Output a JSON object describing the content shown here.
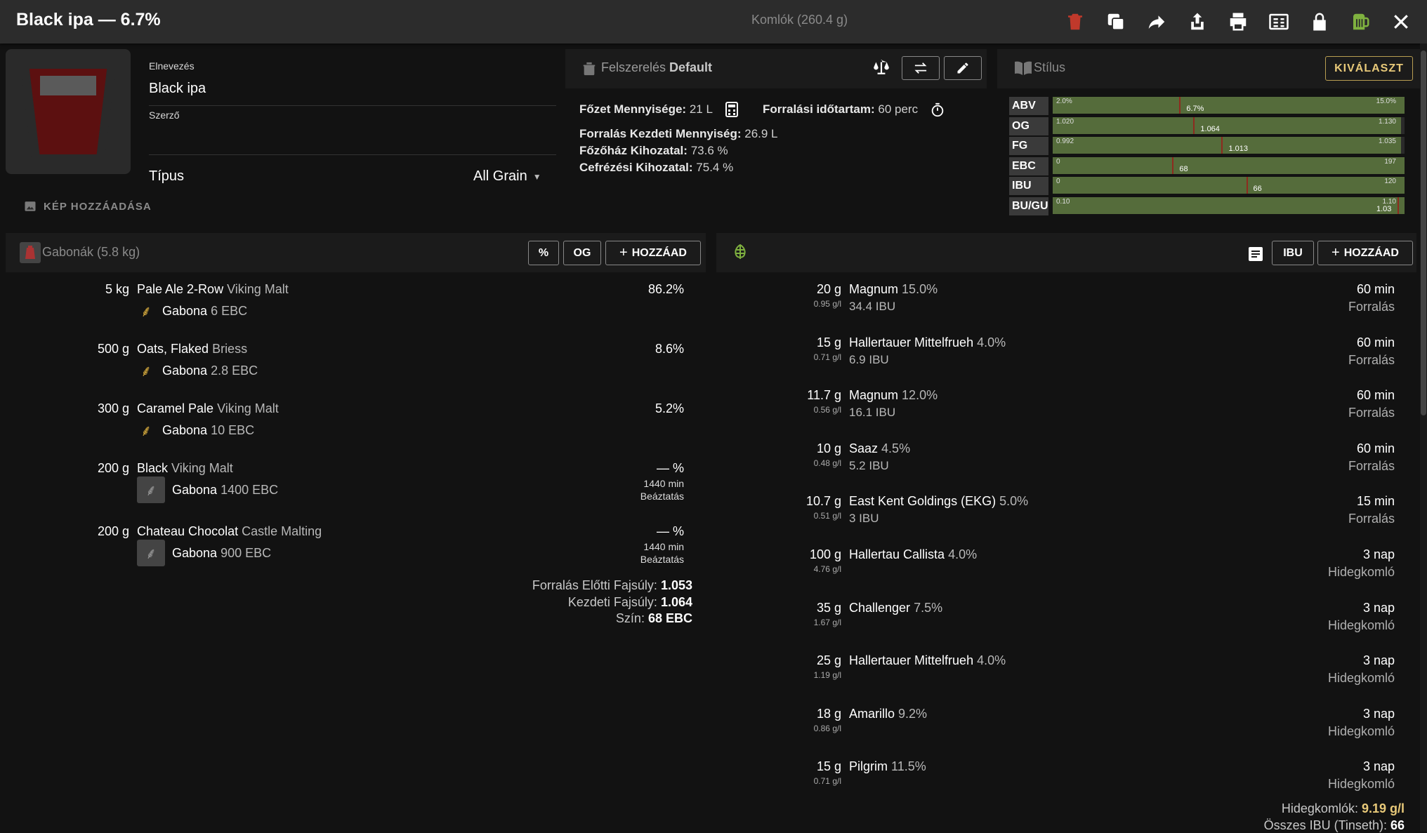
{
  "window": {
    "title": "Black ipa — 6.7%"
  },
  "toolbar": {
    "icons": [
      "trash-icon",
      "copy-icon",
      "share-icon",
      "export-icon",
      "print-icon",
      "newspaper-icon",
      "lock-icon",
      "beer-mug-icon",
      "close-icon"
    ]
  },
  "info": {
    "name_label": "Elnevezés",
    "name_value": "Black ipa",
    "author_label": "Szerző",
    "author_value": "",
    "type_label": "Típus",
    "type_value": "All Grain",
    "add_image": "KÉP HOZZÁADÁSA",
    "glass_color": "#5c1010"
  },
  "equipment": {
    "label": "Felszerelés",
    "value": "Default",
    "batch_label": "Főzet Mennyisége:",
    "batch_value": "21 L",
    "boil_time_label": "Forralási időtartam:",
    "boil_time_value": "60 perc",
    "boil_size_label": "Forralás Kezdeti Mennyiség:",
    "boil_size_value": "26.9 L",
    "brewhouse_label": "Főzőház Kihozatal:",
    "brewhouse_value": "73.6 %",
    "mash_label": "Cefrézési Kihozatal:",
    "mash_value": "75.4 %"
  },
  "style": {
    "label": "Stílus",
    "pick_label": "KIVÁLASZT",
    "gauges": [
      {
        "label": "ABV",
        "min": "2.0%",
        "max": "15.0%",
        "value": "6.7%",
        "range_start": 0.0,
        "range_end": 1.0,
        "marker": 0.36
      },
      {
        "label": "OG",
        "min": "1.020",
        "max": "1.130",
        "value": "1.064",
        "range_start": 0.0,
        "range_end": 0.99,
        "marker": 0.4
      },
      {
        "label": "FG",
        "min": "0.992",
        "max": "1.035",
        "value": "1.013",
        "range_start": 0.0,
        "range_end": 0.99,
        "marker": 0.48
      },
      {
        "label": "EBC",
        "min": "0",
        "max": "197",
        "value": "68",
        "range_start": 0.0,
        "range_end": 1.0,
        "marker": 0.34
      },
      {
        "label": "IBU",
        "min": "0",
        "max": "120",
        "value": "66",
        "range_start": 0.0,
        "range_end": 1.0,
        "marker": 0.55
      },
      {
        "label": "BU/GU",
        "min": "0.10",
        "max": "1.10",
        "value": "1.03",
        "range_start": 0.0,
        "range_end": 1.0,
        "marker": 0.98
      }
    ]
  },
  "grains": {
    "title": "Gabonák (5.8 kg)",
    "pct_button": "%",
    "og_button": "OG",
    "add_button": "HOZZÁAD",
    "items": [
      {
        "amount": "5 kg",
        "name": "Pale Ale 2-Row",
        "supplier": "Viking Malt",
        "type": "Gabona",
        "color": "6 EBC",
        "pct": "86.2%",
        "time": "",
        "use": ""
      },
      {
        "amount": "500 g",
        "name": "Oats, Flaked",
        "supplier": "Briess",
        "type": "Gabona",
        "color": "2.8 EBC",
        "pct": "8.6%",
        "time": "",
        "use": ""
      },
      {
        "amount": "300 g",
        "name": "Caramel Pale",
        "supplier": "Viking Malt",
        "type": "Gabona",
        "color": "10 EBC",
        "pct": "5.2%",
        "time": "",
        "use": ""
      },
      {
        "amount": "200 g",
        "name": "Black",
        "supplier": "Viking Malt",
        "type": "Gabona",
        "color": "1400 EBC",
        "pct": "— %",
        "time": "1440 min",
        "use": "Beáztatás"
      },
      {
        "amount": "200 g",
        "name": "Chateau Chocolat",
        "supplier": "Castle Malting",
        "type": "Gabona",
        "color": "900 EBC",
        "pct": "— %",
        "time": "1440 min",
        "use": "Beáztatás"
      }
    ],
    "pre_boil_label": "Forralás Előtti Fajsúly:",
    "pre_boil_value": "1.053",
    "og_label": "Kezdeti Fajsúly:",
    "og_value": "1.064",
    "color_label": "Szín:",
    "color_value": "68 EBC"
  },
  "hops": {
    "title": "Komlók (260.4 g)",
    "ibu_button": "IBU",
    "add_button": "HOZZÁAD",
    "items": [
      {
        "amount": "20 g",
        "per_l": "0.95 g/l",
        "name": "Magnum",
        "alpha": "15.0%",
        "ibu": "34.4 IBU",
        "time": "60 min",
        "use": "Forralás"
      },
      {
        "amount": "15 g",
        "per_l": "0.71 g/l",
        "name": "Hallertauer Mittelfrueh",
        "alpha": "4.0%",
        "ibu": "6.9 IBU",
        "time": "60 min",
        "use": "Forralás"
      },
      {
        "amount": "11.7 g",
        "per_l": "0.56 g/l",
        "name": "Magnum",
        "alpha": "12.0%",
        "ibu": "16.1 IBU",
        "time": "60 min",
        "use": "Forralás"
      },
      {
        "amount": "10 g",
        "per_l": "0.48 g/l",
        "name": "Saaz",
        "alpha": "4.5%",
        "ibu": "5.2 IBU",
        "time": "60 min",
        "use": "Forralás"
      },
      {
        "amount": "10.7 g",
        "per_l": "0.51 g/l",
        "name": "East Kent Goldings (EKG)",
        "alpha": "5.0%",
        "ibu": "3 IBU",
        "time": "15 min",
        "use": "Forralás"
      },
      {
        "amount": "100 g",
        "per_l": "4.76 g/l",
        "name": "Hallertau Callista",
        "alpha": "4.0%",
        "ibu": "",
        "time": "3 nap",
        "use": "Hidegkomló"
      },
      {
        "amount": "35 g",
        "per_l": "1.67 g/l",
        "name": "Challenger",
        "alpha": "7.5%",
        "ibu": "",
        "time": "3 nap",
        "use": "Hidegkomló"
      },
      {
        "amount": "25 g",
        "per_l": "1.19 g/l",
        "name": "Hallertauer Mittelfrueh",
        "alpha": "4.0%",
        "ibu": "",
        "time": "3 nap",
        "use": "Hidegkomló"
      },
      {
        "amount": "18 g",
        "per_l": "0.86 g/l",
        "name": "Amarillo",
        "alpha": "9.2%",
        "ibu": "",
        "time": "3 nap",
        "use": "Hidegkomló"
      },
      {
        "amount": "15 g",
        "per_l": "0.71 g/l",
        "name": "Pilgrim",
        "alpha": "11.5%",
        "ibu": "",
        "time": "3 nap",
        "use": "Hidegkomló"
      }
    ],
    "dry_hop_label": "Hidegkomlók:",
    "dry_hop_value": "9.19 g/l",
    "total_ibu_label": "Összes IBU (Tinseth):",
    "total_ibu_value": "66"
  }
}
